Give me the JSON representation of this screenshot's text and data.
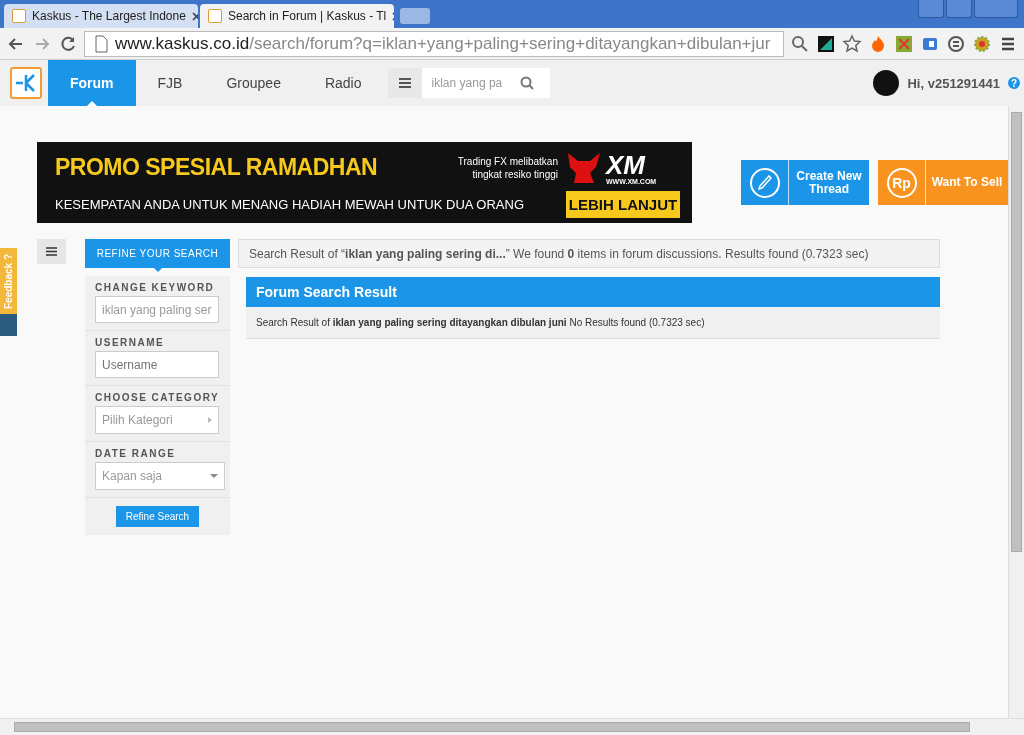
{
  "browser": {
    "tabs": [
      {
        "title": "Kaskus - The Largest Indone",
        "selected": false
      },
      {
        "title": "Search in Forum | Kaskus - Tl",
        "selected": true
      }
    ],
    "address": {
      "host": "www.kaskus.co.id",
      "path": "/search/forum?q=iklan+yang+paling+sering+ditayangkan+dibulan+jur"
    }
  },
  "nav": {
    "items": [
      {
        "label": "Forum",
        "selected": true
      },
      {
        "label": "FJB",
        "selected": false
      },
      {
        "label": "Groupee",
        "selected": false
      },
      {
        "label": "Radio",
        "selected": false
      }
    ],
    "search": {
      "value": "iklan yang pa"
    },
    "greeting": "Hi, v251291441",
    "help": "?"
  },
  "banner": {
    "headline": "PROMO SPESIAL RAMADHAN",
    "subline": "KESEMPATAN ANDA UNTUK MENANG HADIAH MEWAH UNTUK DUA ORANG",
    "note": "Trading FX melibatkan tingkat resiko tinggi",
    "brand": "XM",
    "brand_url": "WWW.XM.COM",
    "cta": "LEBIH LANJUT"
  },
  "actions": [
    {
      "label": "Create New Thread",
      "kind": "create"
    },
    {
      "label": "Want To Sell",
      "kind": "sell",
      "icon_text": "Rp"
    }
  ],
  "feedback": "Feedback ?",
  "refine": {
    "title": "REFINE YOUR SEARCH",
    "sections": [
      {
        "label": "CHANGE KEYWORD",
        "kind": "text",
        "value": "iklan yang paling ser"
      },
      {
        "label": "USERNAME",
        "kind": "text",
        "placeholder": "Username"
      },
      {
        "label": "CHOOSE CATEGORY",
        "kind": "select",
        "value": "Pilih Kategori"
      },
      {
        "label": "DATE RANGE",
        "kind": "dropdown",
        "value": "Kapan saja"
      }
    ],
    "button": "Refine Search"
  },
  "summary": "Search Result of “**iklan yang paling sering di...**” We found **0** items in forum discussions. Results found (0.7323 sec)",
  "result": {
    "title": "Forum Search Result",
    "message": "Search Result of **iklan yang paling sering ditayangkan dibulan juni** No Results found (0.7323 sec)"
  }
}
